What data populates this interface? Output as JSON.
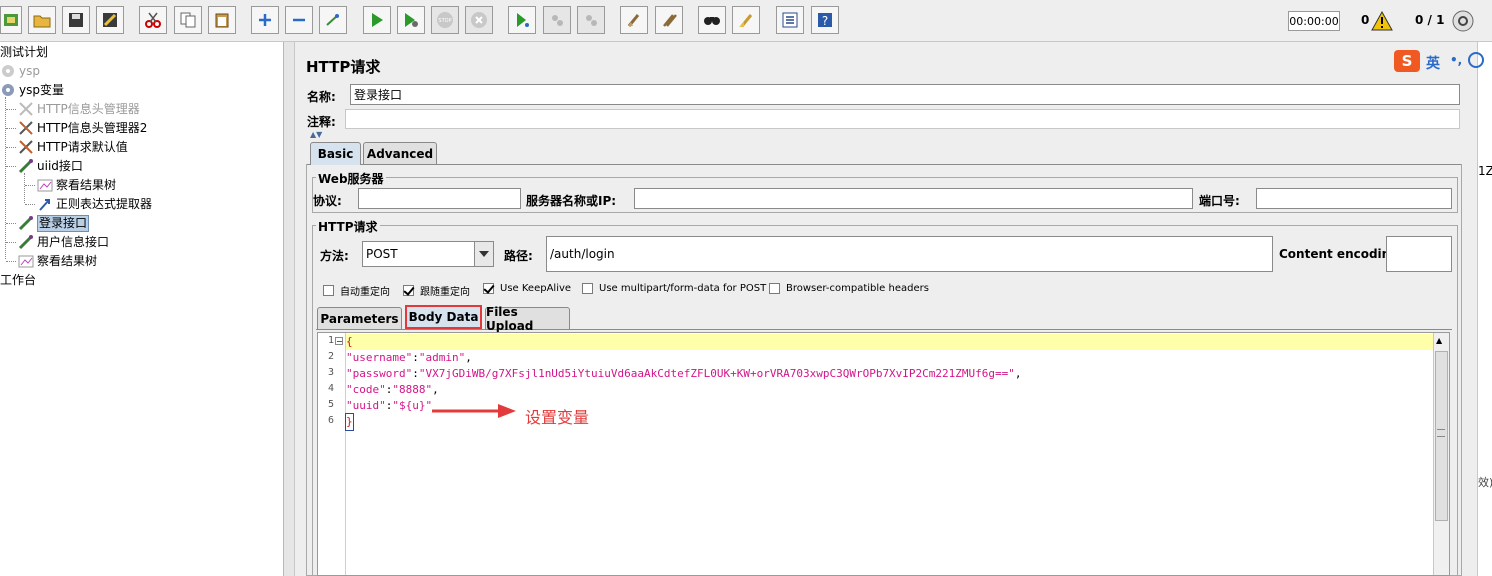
{
  "toolbar": {
    "timer": "00:00:00",
    "warnings_count": "0",
    "threads": "0 / 1"
  },
  "tree": {
    "items": [
      {
        "label": "测试计划"
      },
      {
        "label": "ysp"
      },
      {
        "label": "ysp变量"
      },
      {
        "label": "HTTP信息头管理器"
      },
      {
        "label": "HTTP信息头管理器2"
      },
      {
        "label": "HTTP请求默认值"
      },
      {
        "label": "uiid接口"
      },
      {
        "label": "察看结果树"
      },
      {
        "label": "正则表达式提取器"
      },
      {
        "label": "登录接口"
      },
      {
        "label": "用户信息接口"
      },
      {
        "label": "察看结果树"
      },
      {
        "label": "工作台"
      }
    ]
  },
  "ime": {
    "mode": "英"
  },
  "form": {
    "title": "HTTP请求",
    "name_label": "名称:",
    "name_value": "登录接口",
    "comment_label": "注释:",
    "comment_value": "",
    "tabs": [
      {
        "label": "Basic"
      },
      {
        "label": "Advanced"
      }
    ],
    "web_server": {
      "group_title": "Web服务器",
      "protocol_label": "协议:",
      "protocol_value": "",
      "server_label": "服务器名称或IP:",
      "server_value": "",
      "port_label": "端口号:",
      "port_value": ""
    },
    "http_request": {
      "group_title": "HTTP请求",
      "method_label": "方法:",
      "method_value": "POST",
      "path_label": "路径:",
      "path_value": "/auth/login",
      "encoding_label": "Content encoding:",
      "encoding_value": ""
    },
    "checkboxes": [
      {
        "label": "自动重定向",
        "checked": false
      },
      {
        "label": "跟随重定向",
        "checked": true
      },
      {
        "label": "Use KeepAlive",
        "checked": true
      },
      {
        "label": "Use multipart/form-data for POST",
        "checked": false
      },
      {
        "label": "Browser-compatible headers",
        "checked": false
      }
    ],
    "body_tabs": [
      {
        "label": "Parameters"
      },
      {
        "label": "Body Data"
      },
      {
        "label": "Files Upload"
      }
    ],
    "body_lines": [
      {
        "num": "1",
        "brace": "{"
      },
      {
        "num": "2",
        "key": "\"username\"",
        "sep": ":",
        "val": "\"admin\"",
        "tail": ","
      },
      {
        "num": "3",
        "key": "\"password\"",
        "sep": ":",
        "val": "\"VX7jGDiWB/g7XFsjl1nUd5iYtuiuVd6aaAkCdtefZFL0UK+KW+orVRA703xwpC3QWrOPb7XvIP2Cm221ZMUf6g==\"",
        "tail": ","
      },
      {
        "num": "4",
        "key": "\"code\"",
        "sep": ":",
        "val": "\"8888\"",
        "tail": ","
      },
      {
        "num": "5",
        "key": "\"uuid\"",
        "sep": ":",
        "val": "\"${u}\"",
        "tail": ""
      },
      {
        "num": "6",
        "brace": "}"
      }
    ]
  },
  "annotation": {
    "text": "设置变量"
  },
  "edge_text": {
    "top": "1Z",
    "bottom": "效)"
  },
  "colors": {
    "annotation": "#e33b3b",
    "string": "#d4148a",
    "highlight_line": "#ffffaa",
    "active_tab": "#d6e2ee"
  }
}
